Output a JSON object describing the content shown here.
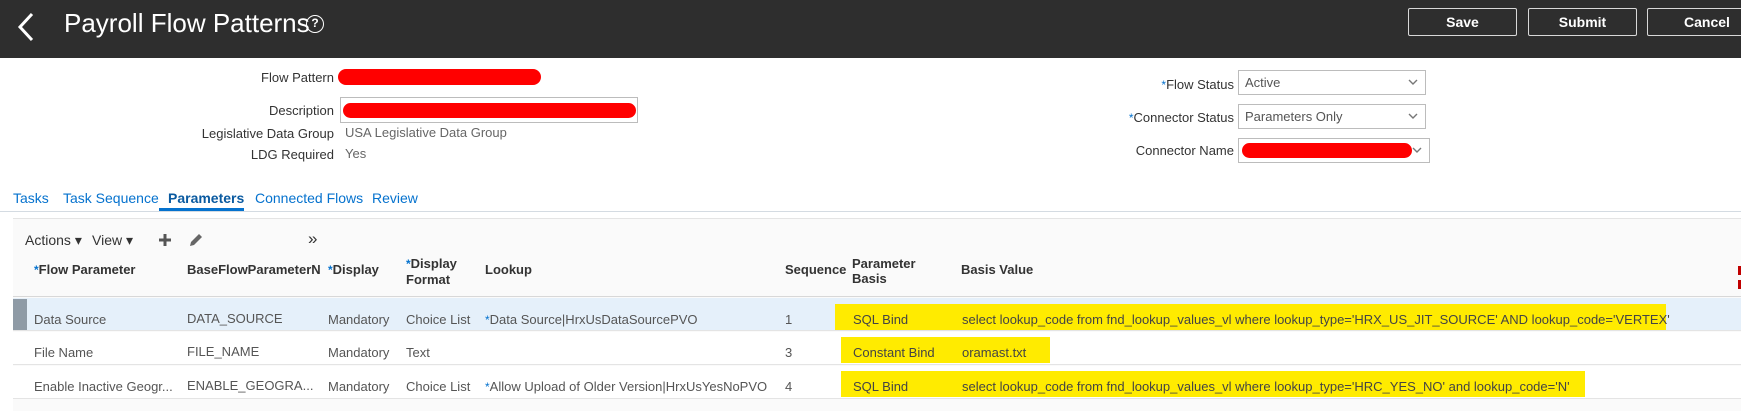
{
  "header": {
    "title": "Payroll Flow Patterns",
    "help_glyph": "?",
    "save_label": "Save",
    "submit_label": "Submit",
    "cancel_label": "Cancel"
  },
  "form": {
    "flow_pattern_label": "Flow Pattern",
    "description_label": "Description",
    "ldg_label": "Legislative Data Group",
    "ldg_value": "USA Legislative Data Group",
    "ldg_required_label": "LDG Required",
    "ldg_required_value": "Yes",
    "flow_status_label": "Flow Status",
    "flow_status_value": "Active",
    "connector_status_label": "Connector Status",
    "connector_status_value": "Parameters Only",
    "connector_name_label": "Connector Name",
    "required_marker": "*"
  },
  "tabs": [
    {
      "label": "Tasks"
    },
    {
      "label": "Task Sequence"
    },
    {
      "label": "Parameters"
    },
    {
      "label": "Connected Flows"
    },
    {
      "label": "Review"
    }
  ],
  "toolbar": {
    "actions_label": "Actions",
    "view_label": "View",
    "overflow_glyph": "»"
  },
  "table": {
    "columns": [
      {
        "label": "Flow Parameter",
        "required": true
      },
      {
        "label": "BaseFlowParameterN",
        "required": false
      },
      {
        "label": "Display",
        "required": true
      },
      {
        "label": "Display",
        "label2": "Format",
        "required": true
      },
      {
        "label": "Lookup",
        "required": false
      },
      {
        "label": "Sequence",
        "required": false
      },
      {
        "label": "Parameter",
        "label2": "Basis",
        "required": false
      },
      {
        "label": "Basis Value",
        "required": false
      }
    ],
    "rows": [
      {
        "flow_parameter": "Data Source",
        "base": "DATA_SOURCE",
        "display": "Mandatory",
        "format": "Choice List",
        "lookup": "Data Source|HrxUsDataSourcePVO",
        "lookup_required": true,
        "sequence": "1",
        "basis": "SQL Bind",
        "basis_value": "select lookup_code from fnd_lookup_values_vl where lookup_type='HRX_US_JIT_SOURCE' AND lookup_code='VERTEX'"
      },
      {
        "flow_parameter": "File Name",
        "base": "FILE_NAME",
        "display": "Mandatory",
        "format": "Text",
        "lookup": "",
        "lookup_required": false,
        "sequence": "3",
        "basis": "Constant Bind",
        "basis_value": "oramast.txt"
      },
      {
        "flow_parameter": "Enable Inactive Geogr...",
        "base": "ENABLE_GEOGRA...",
        "display": "Mandatory",
        "format": "Choice List",
        "lookup": "Allow Upload of Older Version|HrxUsYesNoPVO",
        "lookup_required": true,
        "sequence": "4",
        "basis": "SQL Bind",
        "basis_value": "select lookup_code from fnd_lookup_values_vl where lookup_type='HRC_YES_NO' and lookup_code='N'"
      }
    ]
  },
  "colors": {
    "header_bg": "#2e2e2e",
    "link_blue": "#0572ce",
    "highlight": "#ffeb00",
    "redaction": "#ff0000",
    "selected_row": "#e5f0fa"
  }
}
